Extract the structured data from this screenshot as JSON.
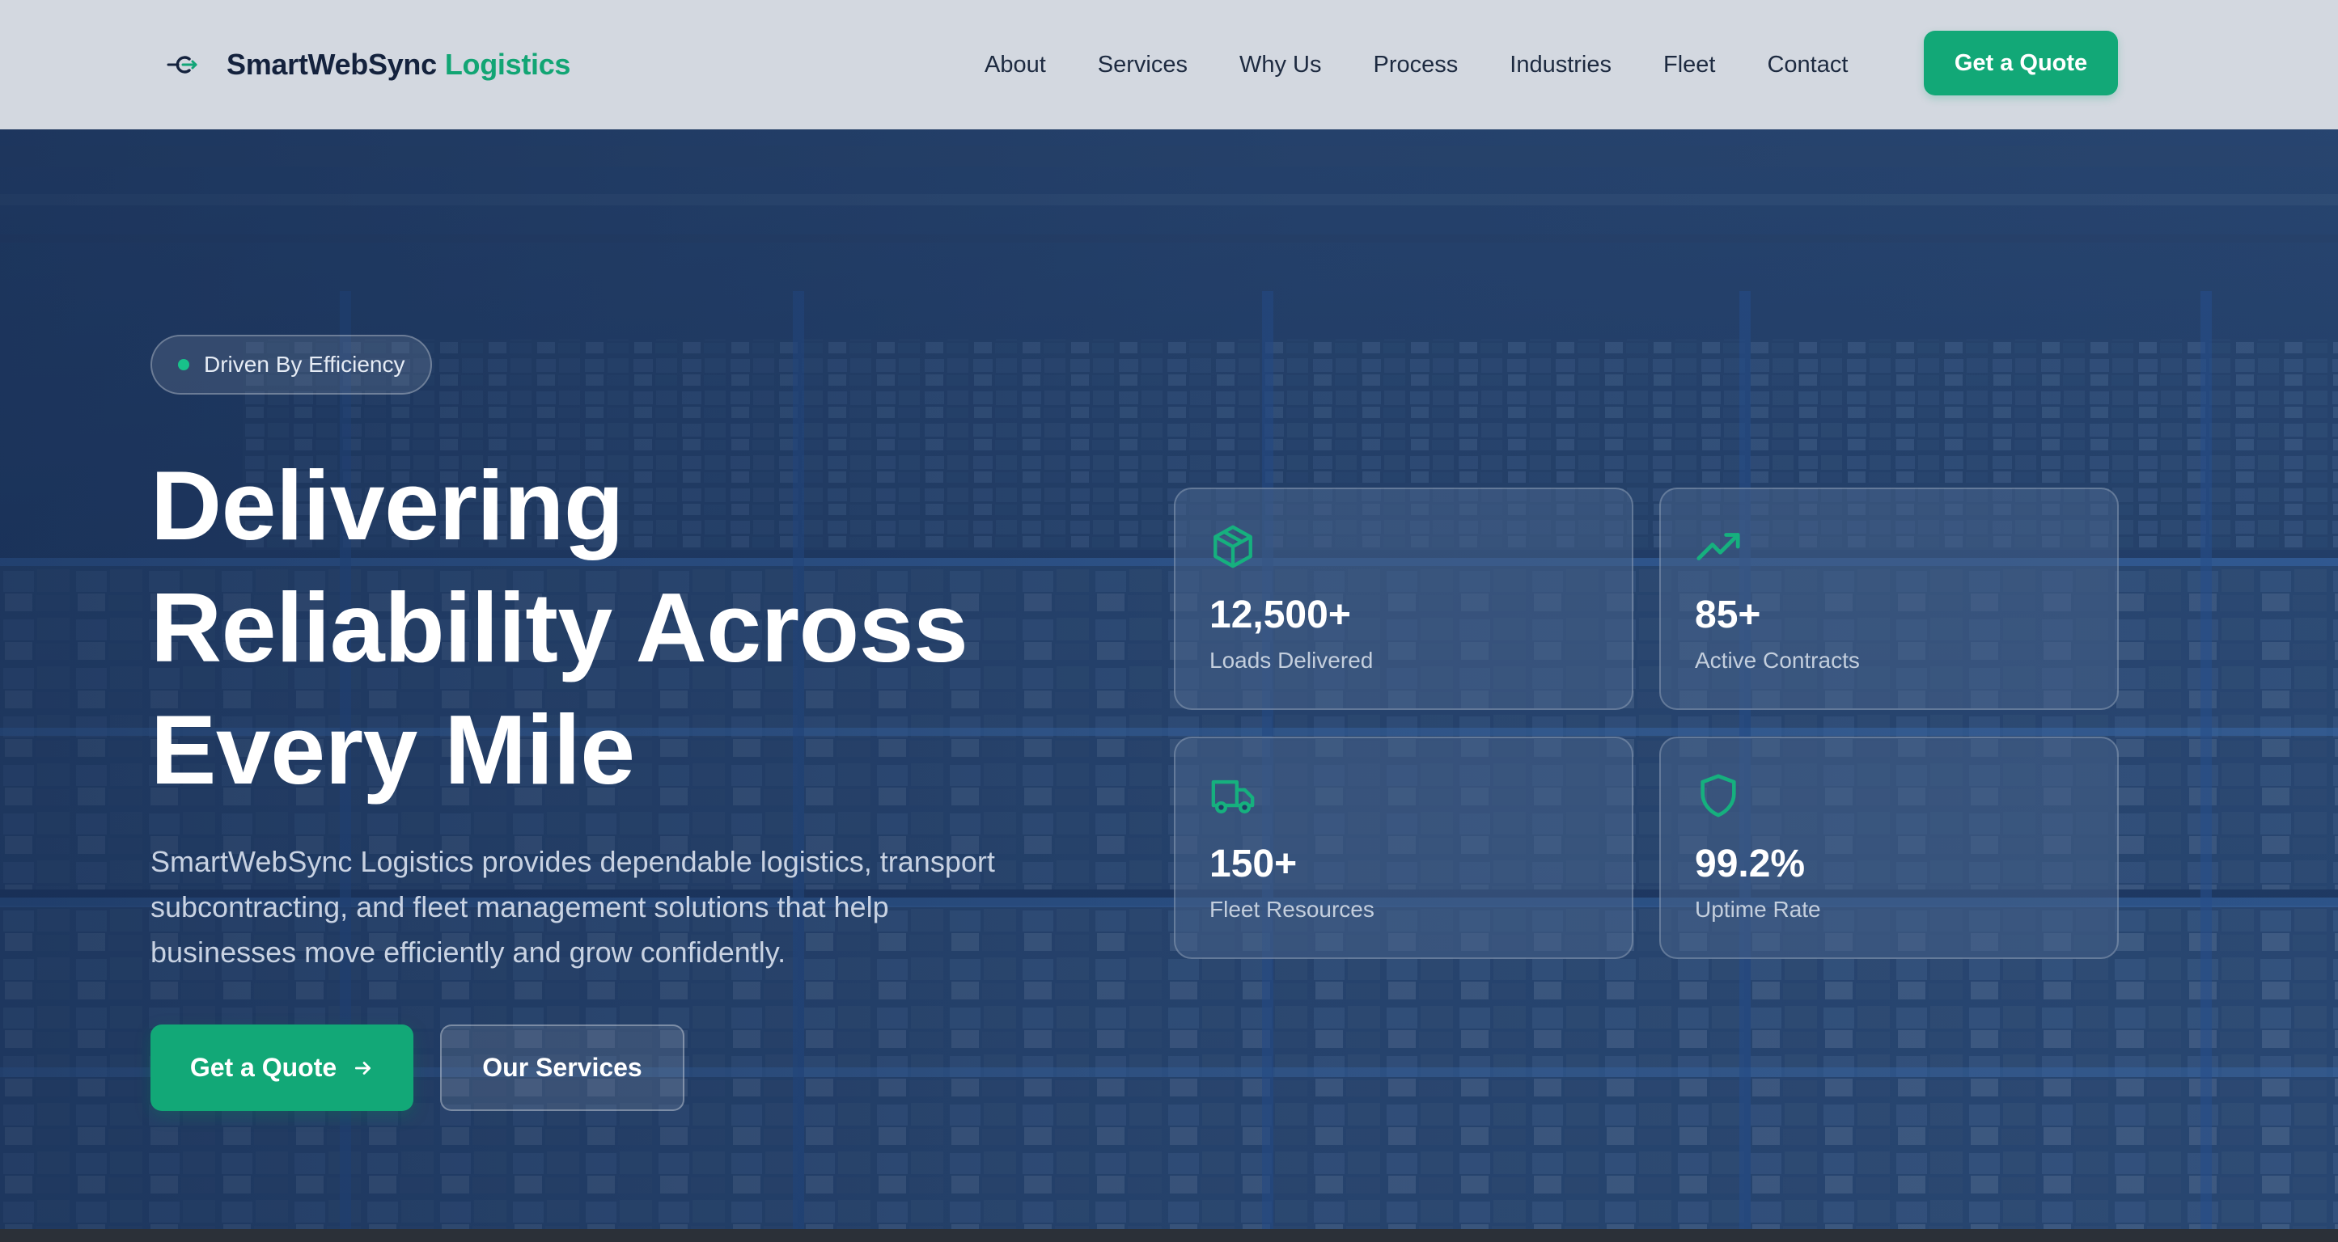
{
  "brand": {
    "name": "SmartWebSync",
    "accent": "Logistics"
  },
  "nav": {
    "links": [
      "About",
      "Services",
      "Why Us",
      "Process",
      "Industries",
      "Fleet",
      "Contact"
    ],
    "cta": "Get a Quote"
  },
  "hero": {
    "badge": "Driven By Efficiency",
    "title_lines": [
      "Delivering",
      "Reliability Across",
      "Every Mile"
    ],
    "description": "SmartWebSync Logistics provides dependable logistics, transport subcontracting, and fleet management solutions that help businesses move efficiently and grow confidently.",
    "primary_button": "Get a Quote",
    "secondary_button": "Our Services"
  },
  "stats": [
    {
      "value": "12,500+",
      "label": "Loads Delivered",
      "icon": "package-icon"
    },
    {
      "value": "85+",
      "label": "Active Contracts",
      "icon": "trending-up-icon"
    },
    {
      "value": "150+",
      "label": "Fleet Resources",
      "icon": "truck-icon"
    },
    {
      "value": "99.2%",
      "label": "Uptime Rate",
      "icon": "shield-icon"
    }
  ],
  "colors": {
    "accent": "#12a877",
    "nav_bg": "#d3d8e0",
    "hero_overlay": "#1a355e",
    "text_dark": "#14223d"
  }
}
